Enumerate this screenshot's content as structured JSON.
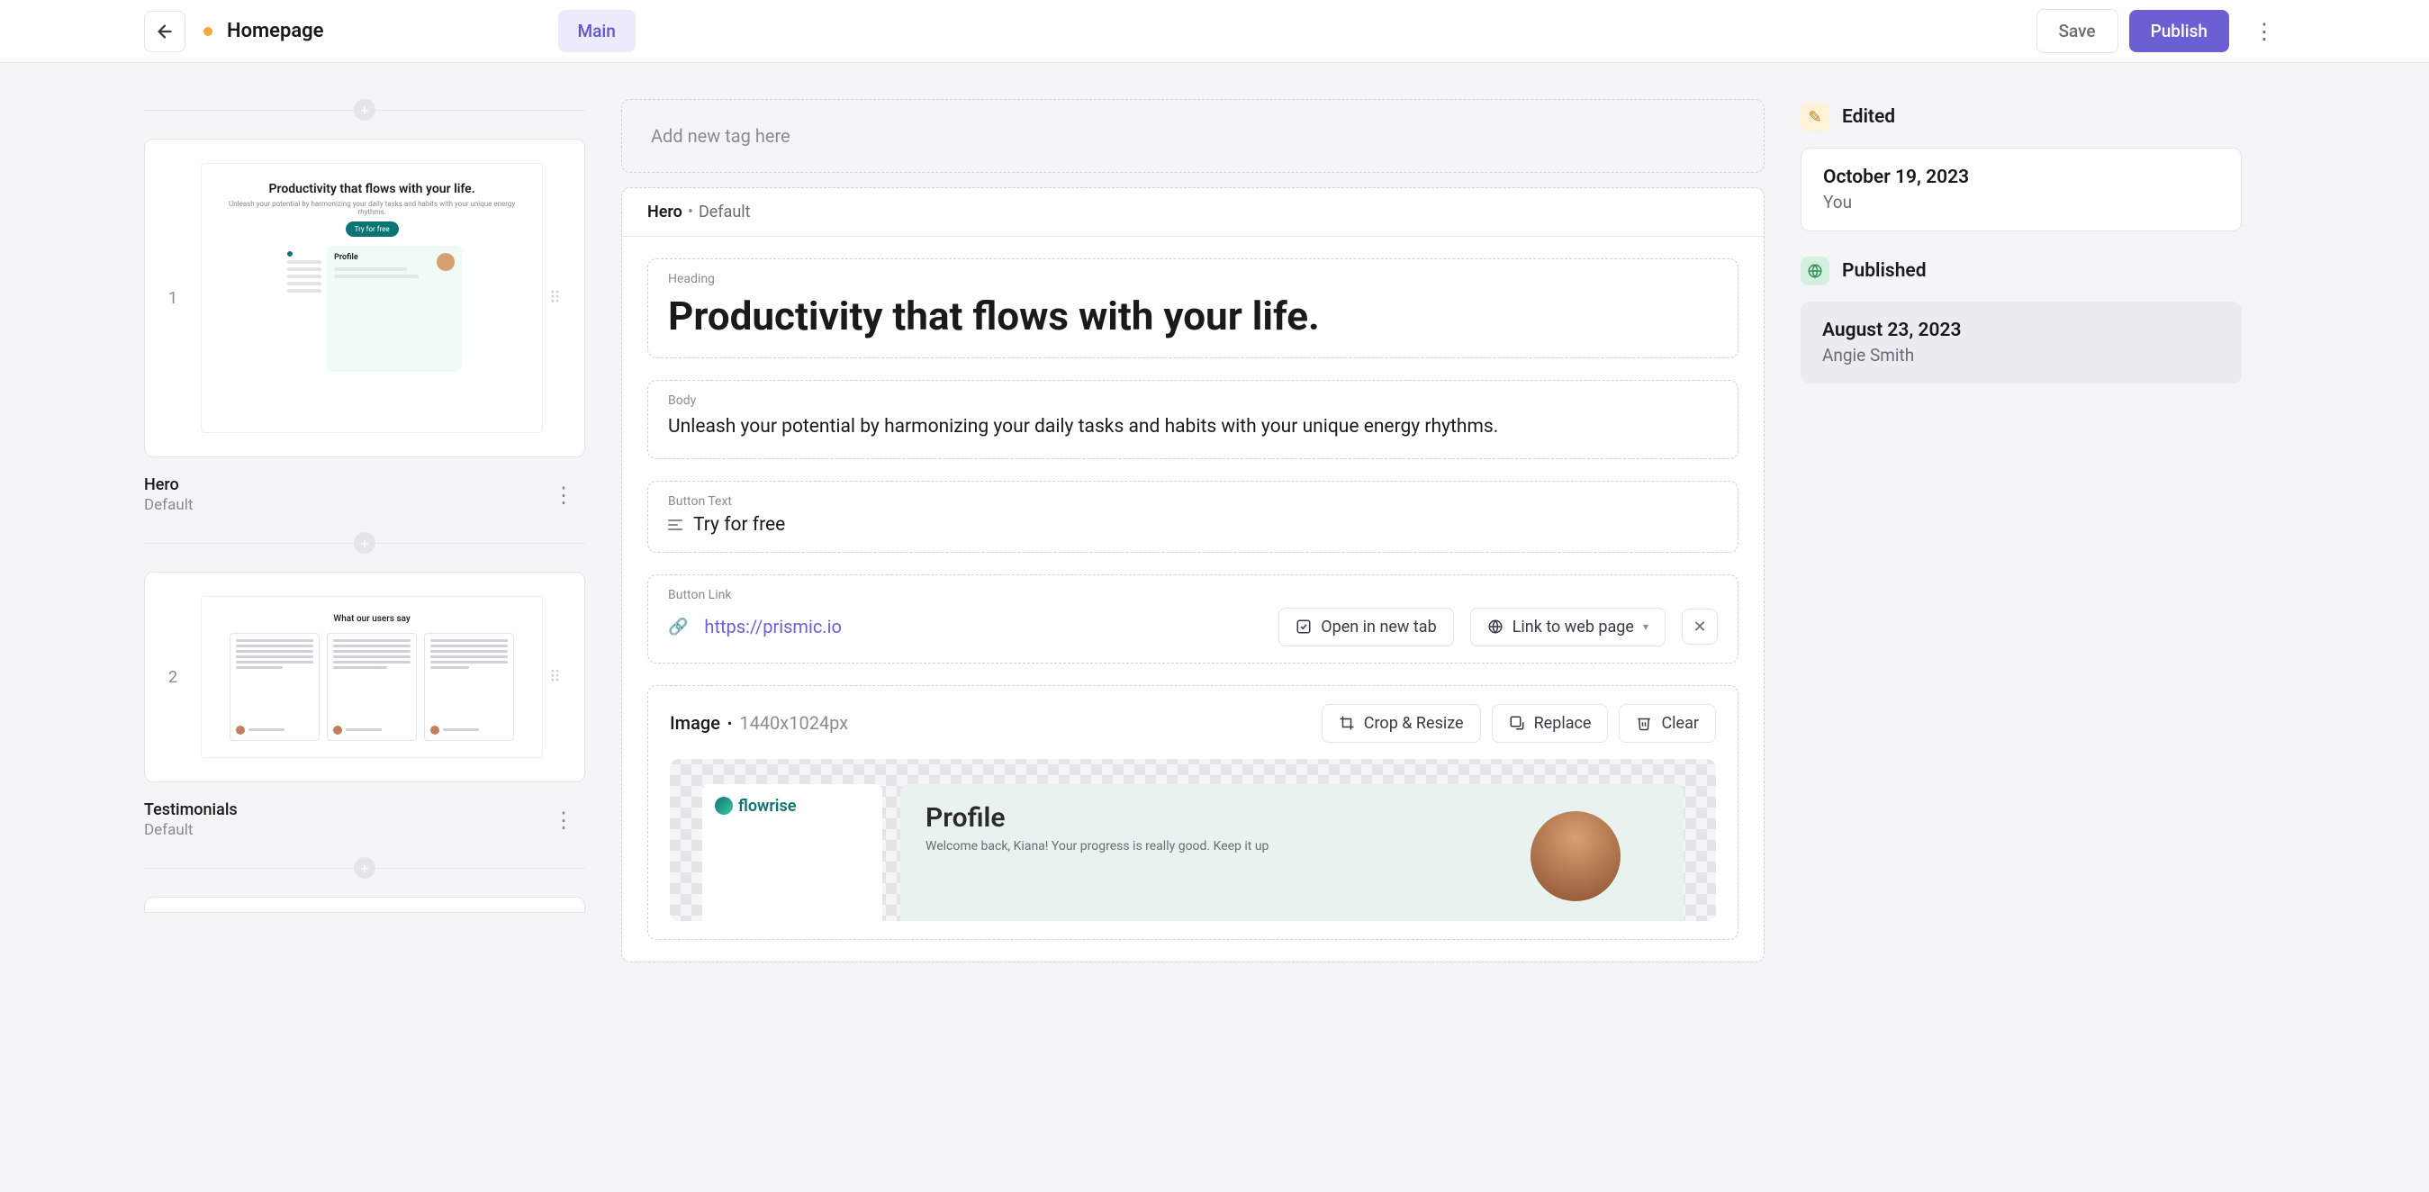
{
  "header": {
    "page_title": "Homepage",
    "tab_main": "Main",
    "save_label": "Save",
    "publish_label": "Publish"
  },
  "sidebar": {
    "slices": [
      {
        "index": "1",
        "name": "Hero",
        "variant": "Default",
        "thumb_title": "Productivity that flows with your life.",
        "thumb_cta": "Try for free"
      },
      {
        "index": "2",
        "name": "Testimonials",
        "variant": "Default",
        "thumb_title": "What our users say"
      }
    ]
  },
  "main": {
    "tag_placeholder": "Add new tag here",
    "slice_title": "Hero",
    "slice_variant": "Default",
    "fields": {
      "heading_label": "Heading",
      "heading_value": "Productivity that flows with your life.",
      "body_label": "Body",
      "body_value": "Unleash your potential by harmonizing your daily tasks and habits with your unique energy rhythms.",
      "button_text_label": "Button Text",
      "button_text_value": "Try for free",
      "button_link_label": "Button Link",
      "button_link_value": "https://prismic.io",
      "open_new_tab_label": "Open in new tab",
      "link_type_label": "Link to web page"
    },
    "image": {
      "label": "Image",
      "dimensions": "1440x1024px",
      "crop_label": "Crop & Resize",
      "replace_label": "Replace",
      "clear_label": "Clear",
      "preview_brand": "flowrise",
      "preview_title": "Profile",
      "preview_sub": "Welcome back, Kiana! Your progress is really good. Keep it up"
    }
  },
  "right": {
    "edited_label": "Edited",
    "edited_date": "October 19, 2023",
    "edited_author": "You",
    "published_label": "Published",
    "published_date": "August 23, 2023",
    "published_author": "Angie Smith"
  }
}
